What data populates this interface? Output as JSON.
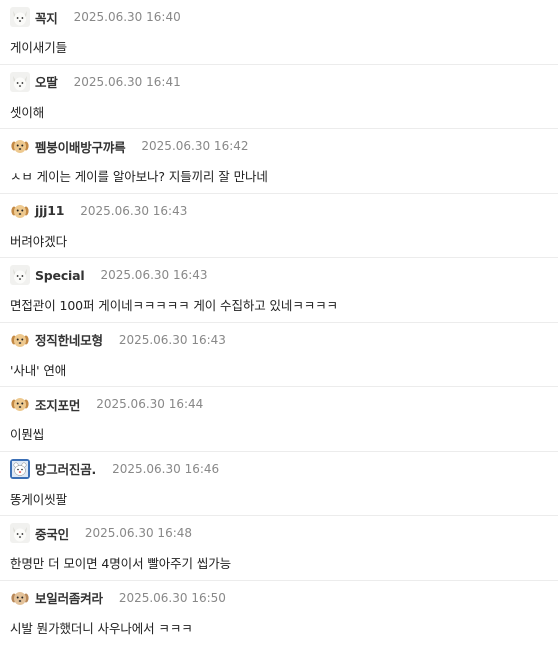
{
  "comments": [
    {
      "nickname": "꼭지",
      "date": "2025.06.30 16:40",
      "text": "게이새기들",
      "avatar": "white-dog-icon"
    },
    {
      "nickname": "오딸",
      "date": "2025.06.30 16:41",
      "text": "셋이해",
      "avatar": "white-dog-icon"
    },
    {
      "nickname": "펨붕이배방구꺄륵",
      "date": "2025.06.30 16:42",
      "text": "ㅅㅂ 게이는 게이를 알아보나? 지들끼리 잘 만나네",
      "avatar": "puppy-icon"
    },
    {
      "nickname": "jjj11",
      "date": "2025.06.30 16:43",
      "text": "버려야겠다",
      "avatar": "puppy-icon"
    },
    {
      "nickname": "Special",
      "date": "2025.06.30 16:43",
      "text": "면접관이 100퍼 게이네ㅋㅋㅋㅋㅋ 게이 수집하고 있네ㅋㅋㅋㅋ",
      "avatar": "white-dog-icon"
    },
    {
      "nickname": "정직한네모형",
      "date": "2025.06.30 16:43",
      "text": "'사내' 연애",
      "avatar": "puppy-icon"
    },
    {
      "nickname": "조지포먼",
      "date": "2025.06.30 16:44",
      "text": "이뭔씹",
      "avatar": "puppy-icon"
    },
    {
      "nickname": "망그러진곰.",
      "date": "2025.06.30 16:46",
      "text": "똥게이씻팔",
      "avatar": "bear-icon"
    },
    {
      "nickname": "중국인",
      "date": "2025.06.30 16:48",
      "text": "한명만 더 모이면 4명이서 빨아주기 씹가능",
      "avatar": "white-dog-icon"
    },
    {
      "nickname": "보일러좀켜라",
      "date": "2025.06.30 16:50",
      "text": "시발 뭔가했더니 사우나에서 ㅋㅋㅋ",
      "avatar": "puppy-icon"
    }
  ]
}
